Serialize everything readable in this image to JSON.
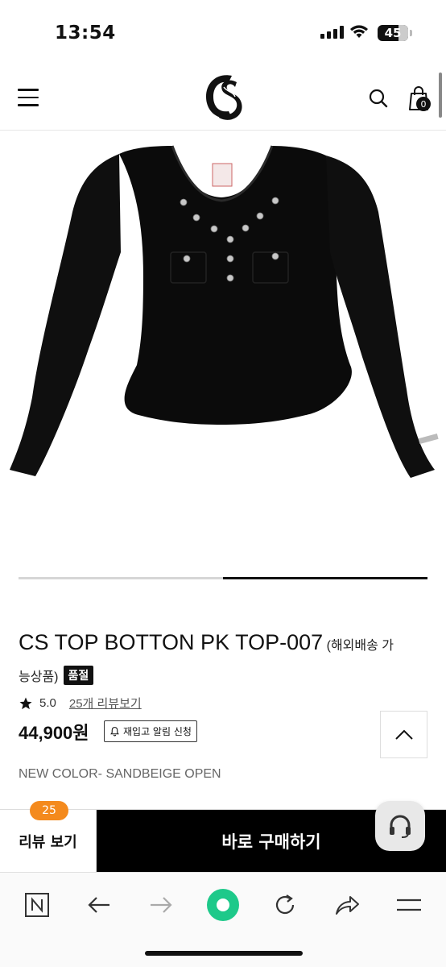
{
  "status_bar": {
    "time": "13:54",
    "battery": "45"
  },
  "header": {
    "cart_count": "0"
  },
  "product": {
    "title": "CS TOP BOTTON PK TOP-007",
    "title_note_1": "(해외배송 가",
    "title_note_2": "능상품)",
    "soldout_badge": "품절",
    "rating": "5.0",
    "review_link": "25개 리뷰보기",
    "price": "44,900원",
    "restock_button": "재입고 알림 신청",
    "notice": "NEW COLOR- SANDBEIGE OPEN",
    "image_slider": {
      "current_index": 2,
      "total": 2
    }
  },
  "bottom_bar": {
    "review_count": "25",
    "review_button": "리뷰 보기",
    "buy_button": "바로 구매하기"
  },
  "browser_toolbar": {
    "icons": [
      "naver-icon",
      "back-icon",
      "forward-icon",
      "green-home-icon",
      "refresh-icon",
      "share-icon",
      "menu-icon"
    ]
  },
  "colors": {
    "accent_orange": "#f48a1d",
    "buy_button": "#000000",
    "home_green": "#1ec98a"
  }
}
